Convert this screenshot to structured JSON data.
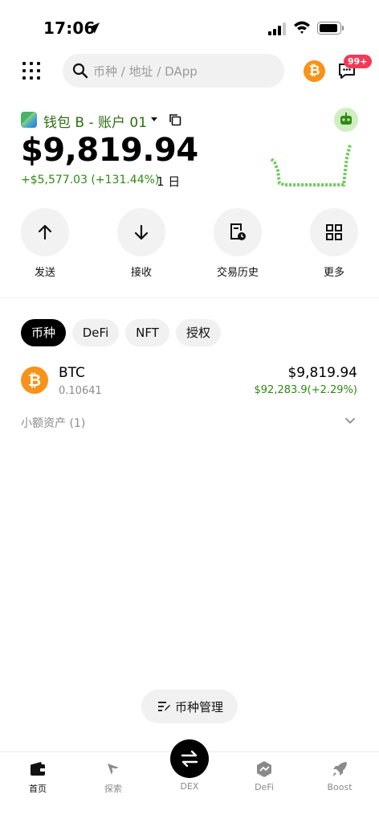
{
  "status_bar": {
    "time": "17:06"
  },
  "search": {
    "placeholder": "币种 / 地址 / DApp"
  },
  "notifications": {
    "badge": "99+"
  },
  "wallet": {
    "name": "钱包 B - 账户 01",
    "balance": "$9,819.94",
    "pnl": "+$5,577.03 (+131.44%)",
    "period": "1 日"
  },
  "actions": [
    {
      "label": "发送",
      "icon": "arrow-up-icon"
    },
    {
      "label": "接收",
      "icon": "arrow-down-icon"
    },
    {
      "label": "交易历史",
      "icon": "history-icon"
    },
    {
      "label": "更多",
      "icon": "grid-icon"
    }
  ],
  "tabs": [
    {
      "label": "币种",
      "active": true
    },
    {
      "label": "DeFi",
      "active": false
    },
    {
      "label": "NFT",
      "active": false
    },
    {
      "label": "授权",
      "active": false
    }
  ],
  "assets": [
    {
      "symbol": "BTC",
      "amount": "0.10641",
      "value": "$9,819.94",
      "price_change": "$92,283.9(+2.29%)"
    }
  ],
  "small_assets": {
    "label": "小额资产 (1)"
  },
  "manage": {
    "label": "币种管理"
  },
  "bottom_nav": [
    {
      "label": "首页",
      "active": true
    },
    {
      "label": "探索",
      "active": false
    },
    {
      "label": "DEX",
      "active": false
    },
    {
      "label": "DeFi",
      "active": false
    },
    {
      "label": "Boost",
      "active": false
    }
  ],
  "colors": {
    "accent_green": "#2f8a12",
    "btc_orange": "#f7931a",
    "badge_red": "#f23a57"
  }
}
